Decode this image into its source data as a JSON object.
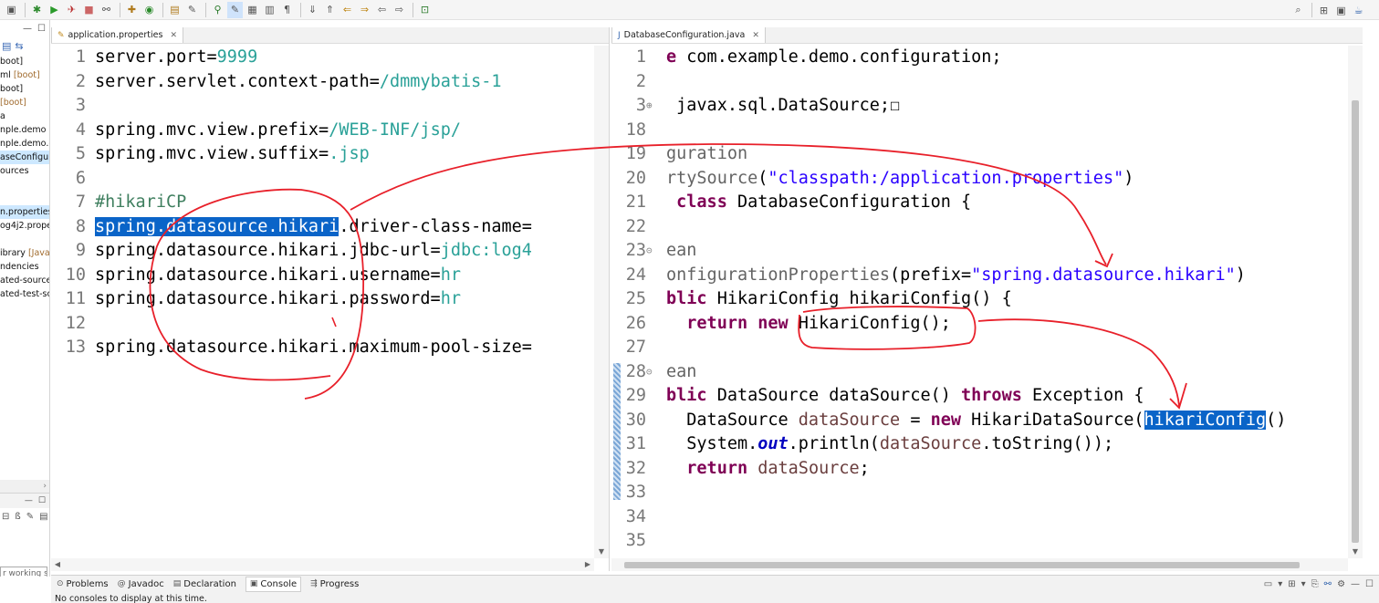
{
  "toolbar": {
    "left_icons": [
      "save-icon",
      "debug-icon",
      "run-icon",
      "external-tools-icon",
      "stop-icon",
      "link-icon",
      "new-java-project-icon",
      "new-class-icon",
      "open-type-icon",
      "search-icon",
      "toggle-mark-icon",
      "highlight-icon",
      "annotation-icon",
      "task-icon",
      "pilcrow-icon",
      "next-annotation-icon",
      "prev-annotation-icon",
      "back-icon",
      "forward-icon",
      "pin-editor-icon"
    ],
    "right_icons": [
      "search-icon",
      "open-perspective-icon",
      "java-perspective-icon"
    ]
  },
  "explorer": {
    "items": [
      {
        "label": "boot]",
        "badge": "",
        "selected": false
      },
      {
        "label": "ml ",
        "badge": "[boot]",
        "selected": false
      },
      {
        "label": "boot]",
        "badge": "",
        "selected": false
      },
      {
        "label": " ",
        "badge": "[boot]",
        "selected": false
      },
      {
        "label": "a",
        "badge": "",
        "selected": false
      },
      {
        "label": "nple.demo",
        "badge": "",
        "selected": false
      },
      {
        "label": "nple.demo.cc",
        "badge": "",
        "selected": false
      },
      {
        "label": "aseConfigura",
        "badge": "",
        "selected": true
      },
      {
        "label": "ources",
        "badge": "",
        "selected": false
      },
      {
        "label": "",
        "badge": "",
        "selected": false
      },
      {
        "label": "",
        "badge": "",
        "selected": false
      },
      {
        "label": "n.properties",
        "badge": "",
        "selected": true
      },
      {
        "label": "og4j2.prope",
        "badge": "",
        "selected": false
      },
      {
        "label": "",
        "badge": "",
        "selected": false
      },
      {
        "label": "ibrary ",
        "badge": "[JavaS",
        "selected": false
      },
      {
        "label": "ndencies",
        "badge": "",
        "selected": false
      },
      {
        "label": "ated-sources",
        "badge": "",
        "selected": false
      },
      {
        "label": "ated-test-sou",
        "badge": "",
        "selected": false
      }
    ],
    "working_set": "r working s"
  },
  "left_editor": {
    "tab": "application.properties",
    "lines": [
      {
        "n": "1",
        "parts": [
          [
            "key",
            "server.port="
          ],
          [
            "val",
            "9999"
          ]
        ]
      },
      {
        "n": "2",
        "parts": [
          [
            "key",
            "server.servlet.context-path="
          ],
          [
            "val",
            "/dmmybatis-1"
          ]
        ]
      },
      {
        "n": "3",
        "parts": []
      },
      {
        "n": "4",
        "parts": [
          [
            "key",
            "spring.mvc.view.prefix="
          ],
          [
            "val",
            "/WEB-INF/jsp/"
          ]
        ]
      },
      {
        "n": "5",
        "parts": [
          [
            "key",
            "spring.mvc.view.suffix="
          ],
          [
            "val",
            ".jsp"
          ]
        ]
      },
      {
        "n": "6",
        "parts": []
      },
      {
        "n": "7",
        "parts": [
          [
            "cmt",
            "#hikariCP"
          ]
        ]
      },
      {
        "n": "8",
        "parts": [
          [
            "hl",
            "spring.datasource.hikari"
          ],
          [
            "key",
            ".driver-class-name="
          ]
        ]
      },
      {
        "n": "9",
        "parts": [
          [
            "key",
            "spring.datasource.hikari.jdbc-url="
          ],
          [
            "val",
            "jdbc:log4"
          ]
        ]
      },
      {
        "n": "10",
        "parts": [
          [
            "key",
            "spring.datasource.hikari.username="
          ],
          [
            "val",
            "hr"
          ]
        ]
      },
      {
        "n": "11",
        "parts": [
          [
            "key",
            "spring.datasource.hikari.password="
          ],
          [
            "val",
            "hr"
          ]
        ]
      },
      {
        "n": "12",
        "parts": []
      },
      {
        "n": "13",
        "parts": [
          [
            "key",
            "spring.datasource.hikari.maximum-pool-size="
          ]
        ]
      }
    ]
  },
  "right_editor": {
    "tab": "DatabaseConfiguration.java",
    "lines": [
      {
        "n": "1",
        "marker": "",
        "parts": [
          [
            "kw",
            "e"
          ],
          [
            "key",
            " com.example.demo.configuration;"
          ]
        ]
      },
      {
        "n": "2",
        "marker": "",
        "parts": []
      },
      {
        "n": "3",
        "marker": "⊕",
        "parts": [
          [
            "key",
            " javax.sql.DataSource;☐"
          ]
        ]
      },
      {
        "n": "18",
        "marker": "",
        "parts": []
      },
      {
        "n": "19",
        "marker": "",
        "parts": [
          [
            "ann",
            "guration"
          ]
        ]
      },
      {
        "n": "20",
        "marker": "",
        "parts": [
          [
            "ann",
            "rtySource"
          ],
          [
            "key",
            "("
          ],
          [
            "str",
            "\"classpath:/application.properties\""
          ],
          [
            "key",
            ")"
          ]
        ]
      },
      {
        "n": "21",
        "marker": "",
        "parts": [
          [
            "kw",
            " class"
          ],
          [
            "key",
            " DatabaseConfiguration {"
          ]
        ]
      },
      {
        "n": "22",
        "marker": "",
        "parts": []
      },
      {
        "n": "23",
        "marker": "⊝",
        "parts": [
          [
            "ann",
            "ean"
          ]
        ]
      },
      {
        "n": "24",
        "marker": "",
        "parts": [
          [
            "ann",
            "onfigurationProperties"
          ],
          [
            "key",
            "(prefix="
          ],
          [
            "str",
            "\"spring.datasource.hikari\""
          ],
          [
            "key",
            ")"
          ]
        ]
      },
      {
        "n": "25",
        "marker": "",
        "parts": [
          [
            "kw",
            "blic"
          ],
          [
            "key",
            " HikariConfig hikariConfig() {"
          ]
        ]
      },
      {
        "n": "26",
        "marker": "",
        "parts": [
          [
            "key",
            "  "
          ],
          [
            "kw",
            "return"
          ],
          [
            "key",
            " "
          ],
          [
            "kw",
            "new"
          ],
          [
            "key",
            " HikariConfig();"
          ]
        ]
      },
      {
        "n": "27",
        "marker": "",
        "parts": []
      },
      {
        "n": "28",
        "marker": "⊝",
        "parts": [
          [
            "ann",
            "ean"
          ]
        ]
      },
      {
        "n": "29",
        "marker": "",
        "parts": [
          [
            "kw",
            "blic"
          ],
          [
            "key",
            " DataSource dataSource() "
          ],
          [
            "kw",
            "throws"
          ],
          [
            "key",
            " Exception {"
          ]
        ]
      },
      {
        "n": "30",
        "marker": "",
        "parts": [
          [
            "key",
            "  DataSource "
          ],
          [
            "var",
            "dataSource"
          ],
          [
            "key",
            " = "
          ],
          [
            "kw",
            "new"
          ],
          [
            "key",
            " HikariDataSource("
          ],
          [
            "hl",
            "hikariConfig"
          ],
          [
            "key",
            "()"
          ]
        ]
      },
      {
        "n": "31",
        "marker": "",
        "parts": [
          [
            "key",
            "  System."
          ],
          [
            "fld",
            "out"
          ],
          [
            "key",
            ".println("
          ],
          [
            "var",
            "dataSource"
          ],
          [
            "key",
            ".toString());"
          ]
        ]
      },
      {
        "n": "32",
        "marker": "",
        "parts": [
          [
            "key",
            "  "
          ],
          [
            "kw",
            "return"
          ],
          [
            "key",
            " "
          ],
          [
            "var",
            "dataSource"
          ],
          [
            "key",
            ";"
          ]
        ]
      },
      {
        "n": "33",
        "marker": "",
        "parts": []
      },
      {
        "n": "34",
        "marker": "",
        "parts": []
      },
      {
        "n": "35",
        "marker": "",
        "parts": []
      }
    ]
  },
  "bottom": {
    "tabs": [
      {
        "label": "Problems",
        "icon": "problems-icon",
        "active": false
      },
      {
        "label": "Javadoc",
        "icon": "javadoc-icon",
        "active": false
      },
      {
        "label": "Declaration",
        "icon": "declaration-icon",
        "active": false
      },
      {
        "label": "Console",
        "icon": "console-icon",
        "active": true
      },
      {
        "label": "Progress",
        "icon": "progress-icon",
        "active": false
      }
    ],
    "message": "No consoles to display at this time."
  },
  "colors": {
    "selection": "#0a64c8",
    "annotation_red": "#e8202a",
    "value_teal": "#2aa198",
    "keyword": "#7f0055",
    "string": "#2a00ff"
  }
}
